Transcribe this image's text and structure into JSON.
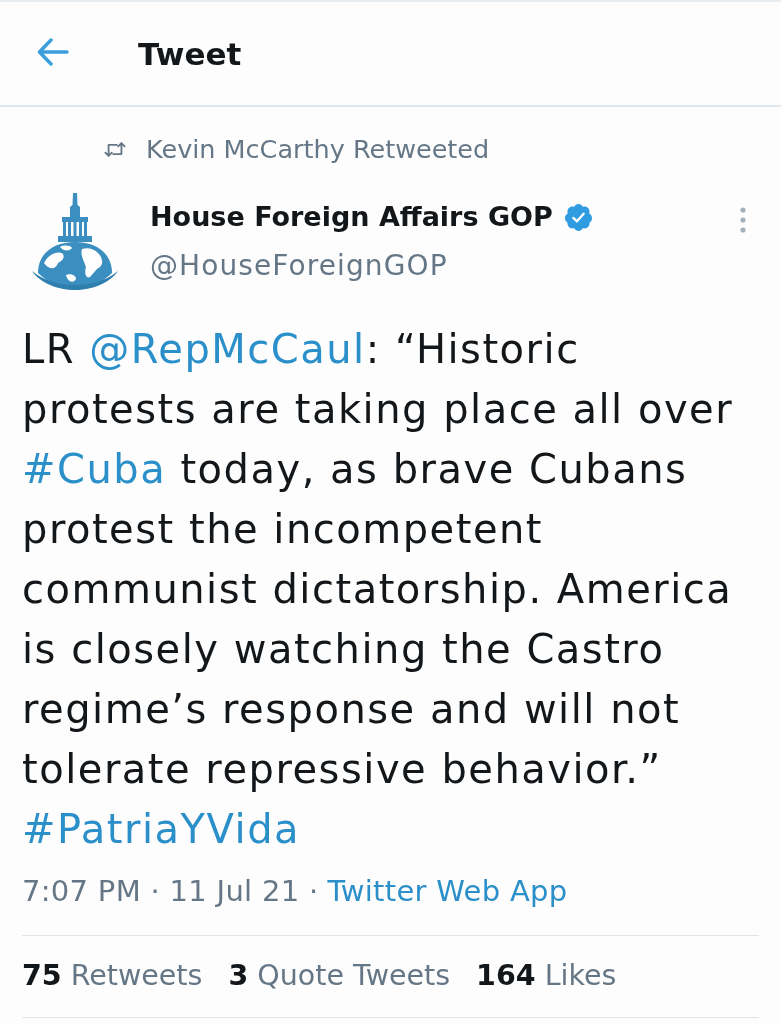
{
  "header": {
    "title": "Tweet"
  },
  "social_context": {
    "text": "Kevin McCarthy Retweeted"
  },
  "author": {
    "name": "House Foreign Affairs GOP",
    "verified": true,
    "handle": "@HouseForeignGOP"
  },
  "body": [
    {
      "kind": "text",
      "text": "LR "
    },
    {
      "kind": "mention",
      "text": "@RepMcCaul"
    },
    {
      "kind": "text",
      "text": ": “Historic protests are taking place all over "
    },
    {
      "kind": "hashtag",
      "text": "#Cuba"
    },
    {
      "kind": "text",
      "text": " today, as brave Cubans protest the incompetent communist dictatorship. America is closely watching the Castro regime’s response and will not tolerate repressive behavior.” "
    },
    {
      "kind": "hashtag",
      "text": "#PatriaYVida"
    }
  ],
  "meta": {
    "timestamp": "7:07 PM · 11 Jul 21 ·",
    "source": "Twitter Web App"
  },
  "stats": [
    {
      "count": "75",
      "label": "Retweets"
    },
    {
      "count": "3",
      "label": "Quote Tweets"
    },
    {
      "count": "164",
      "label": "Likes"
    }
  ]
}
